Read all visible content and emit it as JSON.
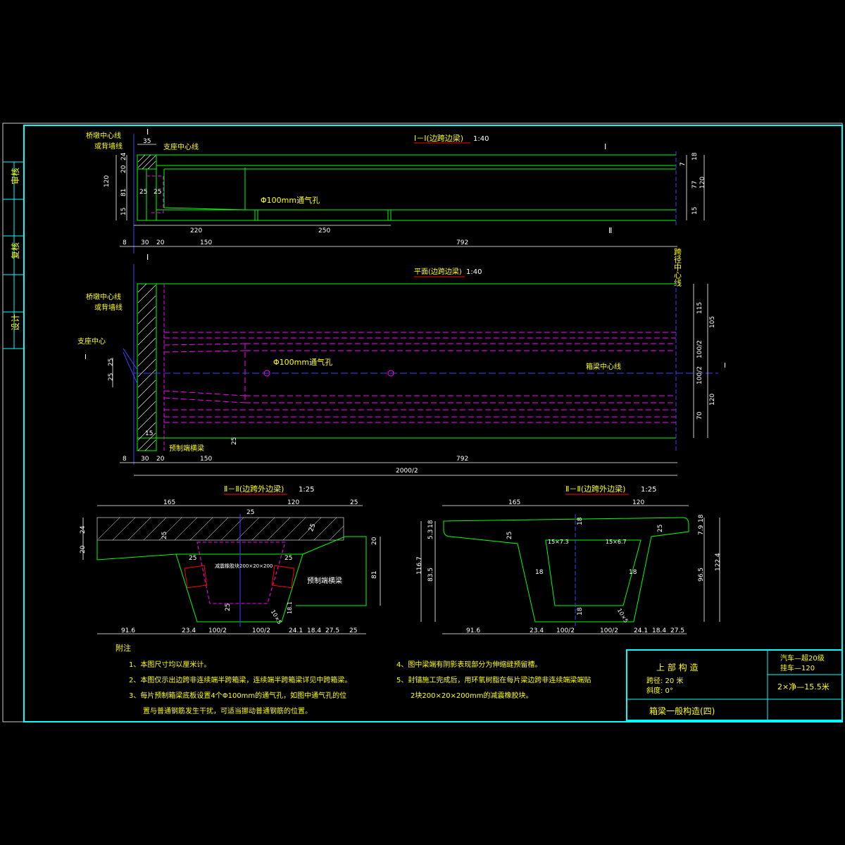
{
  "side_labels": {
    "review": "审核",
    "recheck": "复核",
    "design": "设计"
  },
  "section_1": {
    "title": "Ⅰ－Ⅰ(边跨边梁)",
    "scale": "1:40",
    "left_label_1": "桥墩中心线",
    "left_label_2": "或背墙线",
    "bearing_label": "支座中心线",
    "vent_label": "Φ100mm通气孔",
    "cut_mark": "Ⅰ",
    "cut_mark_2": "Ⅱ",
    "dims_top": [
      "35"
    ],
    "dims_left": [
      "120",
      "24",
      "20",
      "81",
      "15",
      "25",
      "25"
    ],
    "dims_right": [
      "7",
      "18",
      "77",
      "15",
      "120"
    ],
    "dims_mid": [
      "220",
      "250"
    ],
    "dims_bottom": [
      "8",
      "30",
      "20",
      "150",
      "792"
    ]
  },
  "plan": {
    "title": "平面(边跨边梁)",
    "scale": "1:40",
    "left_label_1": "桥墩中心线",
    "left_label_2": "或背墙线",
    "bearing_center": "支座中心",
    "vent_label": "Φ100mm通气孔",
    "centerline_label": "箱梁中心线",
    "end_beam_label": "预制端横梁",
    "span_center": "跨径中心线",
    "dims_left": [
      "25",
      "25"
    ],
    "dims_right": [
      "115",
      "105",
      "100/2",
      "100/2",
      "120",
      "70"
    ],
    "dims_small": [
      "15",
      "25"
    ],
    "dims_bottom": [
      "8",
      "30",
      "20",
      "150",
      "792"
    ],
    "total": "2000/2"
  },
  "section_2a": {
    "title": "Ⅱ－Ⅱ(边跨外边梁)",
    "scale": "1:25",
    "top_dims": [
      "165",
      "120",
      "25"
    ],
    "inner_dims": [
      "25",
      "25",
      "25",
      "25",
      "25"
    ],
    "left_dims": [
      "24",
      "20"
    ],
    "right_dims": [
      "20",
      "81"
    ],
    "rubber_label": "减震橡胶块200×20×200",
    "end_beam_label": "预制端横梁",
    "bottom_dims": [
      "91.6",
      "23.4",
      "100/2",
      "100/2",
      "24.1",
      "18.4",
      "27.5",
      "25"
    ],
    "small": [
      "10×5",
      "18.1"
    ]
  },
  "section_2b": {
    "title": "Ⅱ－Ⅱ(边跨外边梁)",
    "scale": "1:25",
    "top_dims": [
      "165",
      "120"
    ],
    "chamfers": [
      "15×7.3",
      "15×6.7"
    ],
    "inner_dims": [
      "25",
      "18",
      "25",
      "18",
      "18",
      "18"
    ],
    "left_dims": [
      "18",
      "5.3",
      "116.7",
      "83.5"
    ],
    "right_dims": [
      "18",
      "7.9",
      "96.5",
      "122.4"
    ],
    "bottom_dims": [
      "91.6",
      "23.4",
      "100/2",
      "100/2",
      "24.1",
      "18.4",
      "27.5"
    ],
    "small": [
      "10×5"
    ]
  },
  "notes": {
    "heading": "附注",
    "items": [
      "1、本图尺寸均以厘米计。",
      "2、本图仅示出边跨非连续端半跨箱梁，连续端半跨箱梁详见中跨箱梁。",
      "3、每片预制箱梁底板设置4个Φ100mm的通气孔，如图中通气孔的位",
      "置与普通钢筋发生干扰，可适当挪动普通钢筋的位置。",
      "4、图中梁端有阴影表现部分为伸缩缝预留槽。",
      "5、封锚施工完成后，用环氧树脂在每片梁边跨非连续端梁端贴",
      "2块200×20×200mm的减震橡胶块。"
    ]
  },
  "title_block": {
    "part": "上 部 构 造",
    "span": "跨径: 20 米",
    "skew": "斜度: 0°",
    "load_1": "汽车—超20级",
    "load_2": "挂车—120",
    "width": "2×净—15.5米",
    "drawing_name": "箱梁一般构造(四)"
  },
  "colors": {
    "frame": "#00ffff",
    "outline": "#00ff00",
    "hidden": "#ff00ff",
    "text": "#ffff00",
    "dim": "#ffffff",
    "center": "#4040ff"
  }
}
